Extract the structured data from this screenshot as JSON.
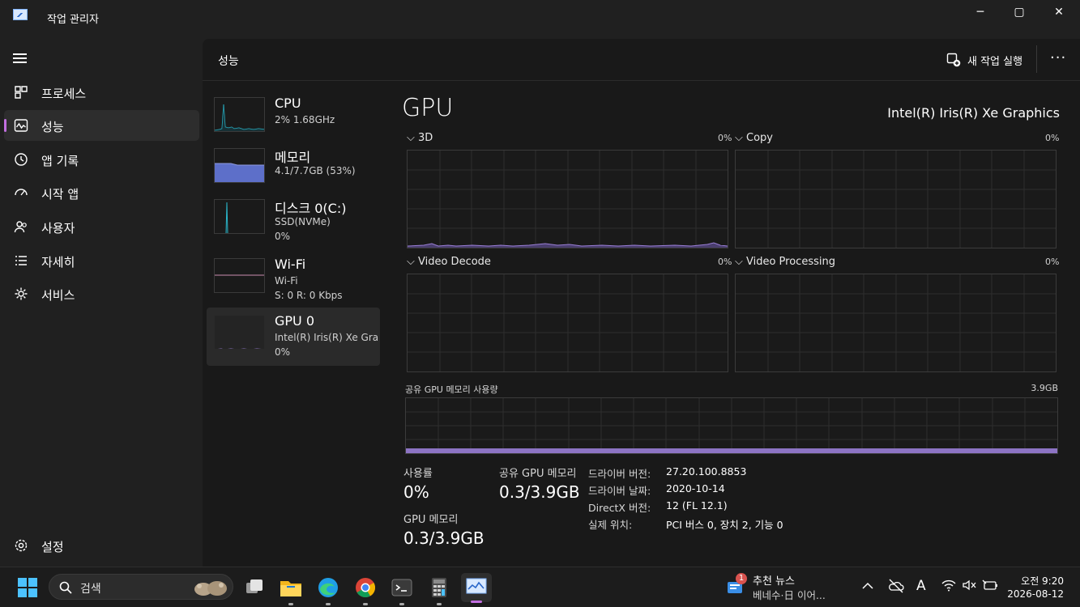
{
  "window": {
    "title": "작업 관리자",
    "app_icon": "task-manager-icon",
    "controls": {
      "minimize": "─",
      "maximize": "▢",
      "close": "✕"
    }
  },
  "nav": {
    "menu_icon": "hamburger-icon",
    "items": [
      {
        "label": "프로세스",
        "icon": "processes-icon"
      },
      {
        "label": "성능",
        "icon": "performance-icon",
        "active": true
      },
      {
        "label": "앱 기록",
        "icon": "history-icon"
      },
      {
        "label": "시작 앱",
        "icon": "startup-icon"
      },
      {
        "label": "사용자",
        "icon": "users-icon"
      },
      {
        "label": "자세히",
        "icon": "details-icon"
      },
      {
        "label": "서비스",
        "icon": "services-icon"
      }
    ],
    "settings_label": "설정"
  },
  "header": {
    "title": "성능",
    "run_task_label": "새 작업 실행",
    "more_icon": "···"
  },
  "resources": [
    {
      "name": "CPU",
      "sub1": "2% 1.68GHz",
      "sub2": ""
    },
    {
      "name": "메모리",
      "sub1": "4.1/7.7GB (53%)",
      "sub2": ""
    },
    {
      "name": "디스크 0(C:)",
      "sub1": "SSD(NVMe)",
      "sub2": "0%"
    },
    {
      "name": "Wi-Fi",
      "sub1": "Wi-Fi",
      "sub2": "S: 0  R: 0 Kbps"
    },
    {
      "name": "GPU 0",
      "sub1": "Intel(R) Iris(R) Xe Gra...",
      "sub2": "0%",
      "active": true
    }
  ],
  "gpu": {
    "title": "GPU",
    "model": "Intel(R) Iris(R) Xe Graphics",
    "engines": [
      {
        "label": "3D",
        "percent": "0%"
      },
      {
        "label": "Copy",
        "percent": "0%"
      },
      {
        "label": "Video Decode",
        "percent": "0%"
      },
      {
        "label": "Video Processing",
        "percent": "0%"
      }
    ],
    "shared_memory_label": "공유 GPU 메모리 사용량",
    "shared_memory_max": "3.9GB",
    "stats": {
      "utilization_label": "사용률",
      "utilization_value": "0%",
      "shared_mem_label": "공유 GPU 메모리",
      "shared_mem_value": "0.3/3.9GB",
      "gpu_mem_label": "GPU 메모리",
      "gpu_mem_value": "0.3/3.9GB"
    },
    "info": [
      {
        "key": "드라이버 버전:",
        "value": "27.20.100.8853"
      },
      {
        "key": "드라이버 날짜:",
        "value": "2020-10-14"
      },
      {
        "key": "DirectX 버전:",
        "value": "12 (FL 12.1)"
      },
      {
        "key": "실제 위치:",
        "value": "PCI 버스 0, 장치 2, 기능 0"
      }
    ]
  },
  "taskbar": {
    "search_placeholder": "검색",
    "news_badge": "1",
    "news_title": "추천 뉴스",
    "news_sub": "베네수·日 이어...",
    "ime": "A",
    "time": "오전 9:20",
    "date": "2026-08-12"
  },
  "colors": {
    "accent": "#c26fe0",
    "gpu_line": "#9a7fd6",
    "memory_fill": "#5d6fc9",
    "cpu_line": "#2ab4c8"
  }
}
